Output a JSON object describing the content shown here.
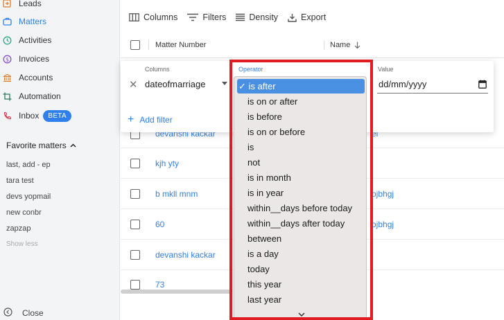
{
  "sidebar": {
    "items": [
      {
        "label": "Leads",
        "icon": "leads-icon",
        "active": false
      },
      {
        "label": "Matters",
        "icon": "briefcase-icon",
        "active": true
      },
      {
        "label": "Activities",
        "icon": "clock-icon",
        "active": false
      },
      {
        "label": "Invoices",
        "icon": "dollar-icon",
        "active": false
      },
      {
        "label": "Accounts",
        "icon": "bank-icon",
        "active": false
      },
      {
        "label": "Automation",
        "icon": "crop-icon",
        "active": false
      },
      {
        "label": "Inbox",
        "icon": "phone-icon",
        "active": false,
        "badge": "BETA"
      }
    ],
    "favorites_title": "Favorite matters",
    "favorites": [
      "last, add - ep",
      "tara test",
      "devs yopmail",
      "new conbr",
      "zapzap"
    ],
    "show_less": "Show less",
    "close_label": "Close"
  },
  "toolbar": {
    "columns_label": "Columns",
    "filters_label": "Filters",
    "density_label": "Density",
    "export_label": "Export"
  },
  "table": {
    "headers": [
      "Matter Number",
      "Name"
    ],
    "rows": [
      {
        "matter": "devanshi kackar",
        "name_partial": "el"
      },
      {
        "matter": "kjh yty",
        "name_partial": ""
      },
      {
        "matter": "b mkll mnm",
        "name_partial": "ojbhgj"
      },
      {
        "matter": "60",
        "name_partial": "ojbhgj"
      },
      {
        "matter": "devanshi kackar",
        "name_partial": ""
      },
      {
        "matter": "73",
        "name_partial": ""
      }
    ]
  },
  "filter_panel": {
    "columns_label": "Columns",
    "column_value": "dateofmarriage",
    "operator_label": "Operator",
    "value_label": "Value",
    "value_placeholder": "dd/mm/yyyy",
    "add_filter_label": "Add filter"
  },
  "operator_options": [
    "is after",
    "is on or after",
    "is before",
    "is on or before",
    "is",
    "not",
    "is in month",
    "is in year",
    "within__days before today",
    "within__days after today",
    "between",
    "is a day",
    "today",
    "this year",
    "last year"
  ],
  "selected_operator": "is after",
  "colors": {
    "accent": "#2f80ed",
    "highlight": "#e21b23",
    "selected_option": "#4a90e2",
    "dropdown_bg": "#ebe7e6"
  }
}
